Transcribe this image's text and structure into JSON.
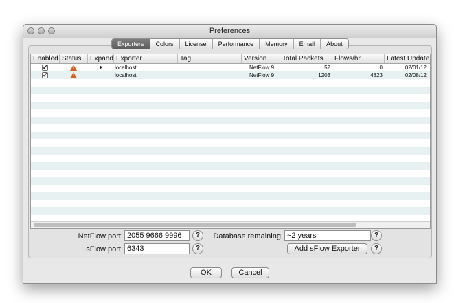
{
  "window": {
    "title": "Preferences"
  },
  "tabs": [
    {
      "label": "Exporters",
      "selected": true
    },
    {
      "label": "Colors",
      "selected": false
    },
    {
      "label": "License",
      "selected": false
    },
    {
      "label": "Performance",
      "selected": false
    },
    {
      "label": "Memory",
      "selected": false
    },
    {
      "label": "Email",
      "selected": false
    },
    {
      "label": "About",
      "selected": false
    }
  ],
  "table": {
    "columns": [
      "Enabled",
      "Status",
      "Expand",
      "Exporter",
      "Tag",
      "Version",
      "Total Packets",
      "Flows/hr",
      "Latest Update"
    ],
    "rows": [
      {
        "enabled": true,
        "status": "warning-icon",
        "expandable": true,
        "exporter": "localhost",
        "tag": "",
        "version": "NetFlow 9",
        "total_packets": "52",
        "flows_hr": "0",
        "latest_update": "02/01/12"
      },
      {
        "enabled": true,
        "status": "warning-icon",
        "expandable": false,
        "exporter": "localhost",
        "tag": "",
        "version": "NetFlow 9",
        "total_packets": "1203",
        "flows_hr": "4823",
        "latest_update": "02/08/12"
      }
    ]
  },
  "form": {
    "netflow_label": "NetFlow port:",
    "netflow_value": "2055 9666 9996",
    "sflow_label": "sFlow port:",
    "sflow_value": "6343",
    "db_label": "Database remaining:",
    "db_value": "~2 years",
    "add_sflow_label": "Add sFlow Exporter",
    "help_glyph": "?"
  },
  "buttons": {
    "ok": "OK",
    "cancel": "Cancel"
  },
  "colors": {
    "warning": "#d65c1c",
    "selected_tab": "#6a6a6a",
    "row_stripe": "#e7f1f1"
  }
}
